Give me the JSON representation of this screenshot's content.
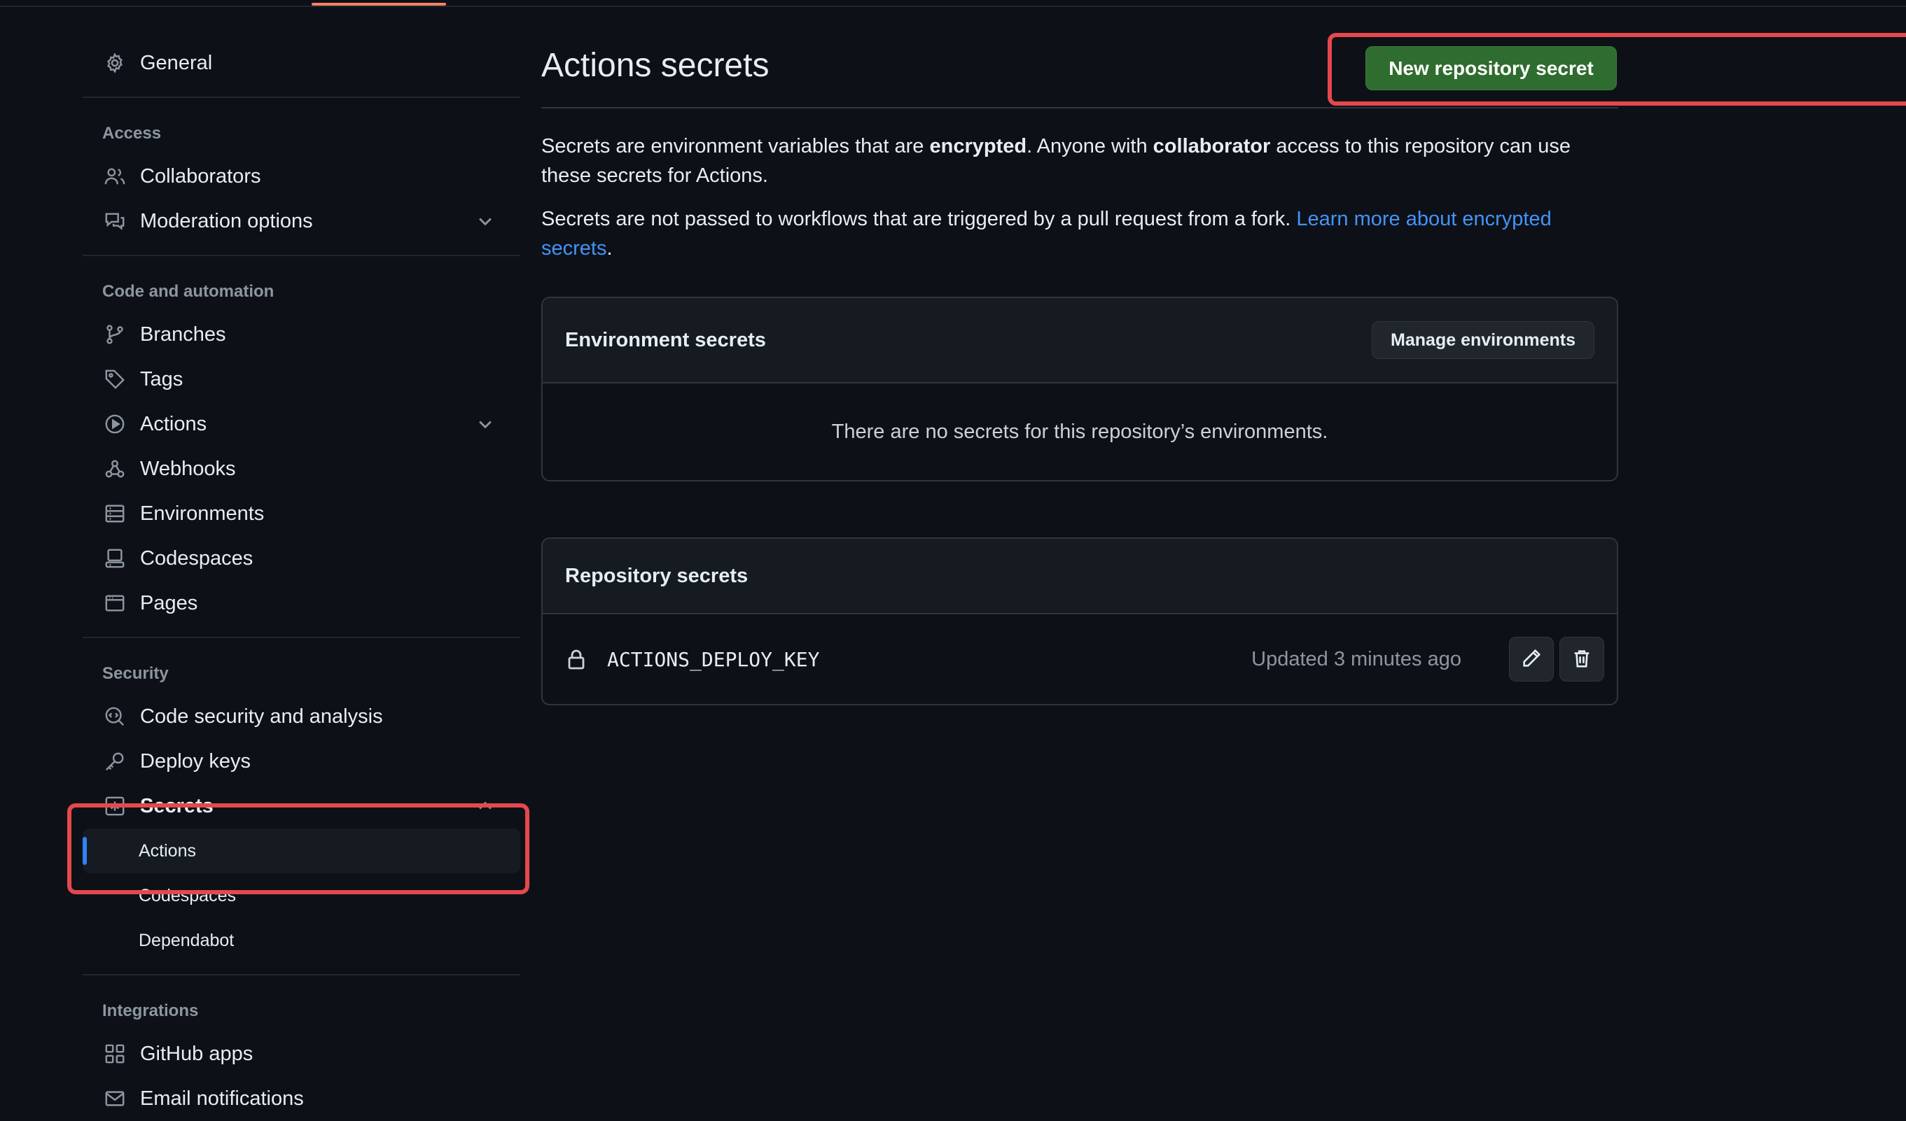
{
  "sidebar": {
    "general": {
      "label": "General",
      "icon": "gear-icon"
    },
    "sections": {
      "access": {
        "heading": "Access",
        "items": [
          {
            "label": "Collaborators",
            "icon": "people-icon"
          },
          {
            "label": "Moderation options",
            "icon": "comment-discussion-icon",
            "expandable": true
          }
        ]
      },
      "code_automation": {
        "heading": "Code and automation",
        "items": [
          {
            "label": "Branches",
            "icon": "git-branch-icon"
          },
          {
            "label": "Tags",
            "icon": "tag-icon"
          },
          {
            "label": "Actions",
            "icon": "play-icon",
            "expandable": true
          },
          {
            "label": "Webhooks",
            "icon": "webhook-icon"
          },
          {
            "label": "Environments",
            "icon": "server-icon"
          },
          {
            "label": "Codespaces",
            "icon": "codespaces-icon"
          },
          {
            "label": "Pages",
            "icon": "browser-icon"
          }
        ]
      },
      "security": {
        "heading": "Security",
        "items": [
          {
            "label": "Code security and analysis",
            "icon": "codescan-icon"
          },
          {
            "label": "Deploy keys",
            "icon": "key-icon"
          },
          {
            "label": "Secrets",
            "icon": "secret-asterisk-icon",
            "expanded": true
          }
        ],
        "secrets_subitems": [
          {
            "label": "Actions",
            "active": true
          },
          {
            "label": "Codespaces"
          },
          {
            "label": "Dependabot"
          }
        ]
      },
      "integrations": {
        "heading": "Integrations",
        "items": [
          {
            "label": "GitHub apps",
            "icon": "apps-icon"
          },
          {
            "label": "Email notifications",
            "icon": "mail-icon"
          }
        ]
      }
    }
  },
  "main": {
    "title": "Actions secrets",
    "new_secret_button": "New repository secret",
    "description": {
      "p1_a": "Secrets are environment variables that are ",
      "p1_b": "encrypted",
      "p1_c": ". Anyone with ",
      "p1_d": "collaborator",
      "p1_e": " access to this repository can use these secrets for Actions.",
      "p2_a": "Secrets are not passed to workflows that are triggered by a pull request from a fork. ",
      "p2_link": "Learn more about encrypted secrets",
      "p2_end": "."
    },
    "environment_secrets": {
      "heading": "Environment secrets",
      "manage_button": "Manage environments",
      "empty_text": "There are no secrets for this repository’s environments."
    },
    "repository_secrets": {
      "heading": "Repository secrets",
      "rows": [
        {
          "name": "ACTIONS_DEPLOY_KEY",
          "updated": "Updated 3 minutes ago"
        }
      ]
    }
  },
  "colors": {
    "background": "#0d1117",
    "primary_button": "#2f6c2f",
    "link": "#4493f8",
    "highlight": "#e5484d",
    "active_indicator": "#2f81f7"
  }
}
